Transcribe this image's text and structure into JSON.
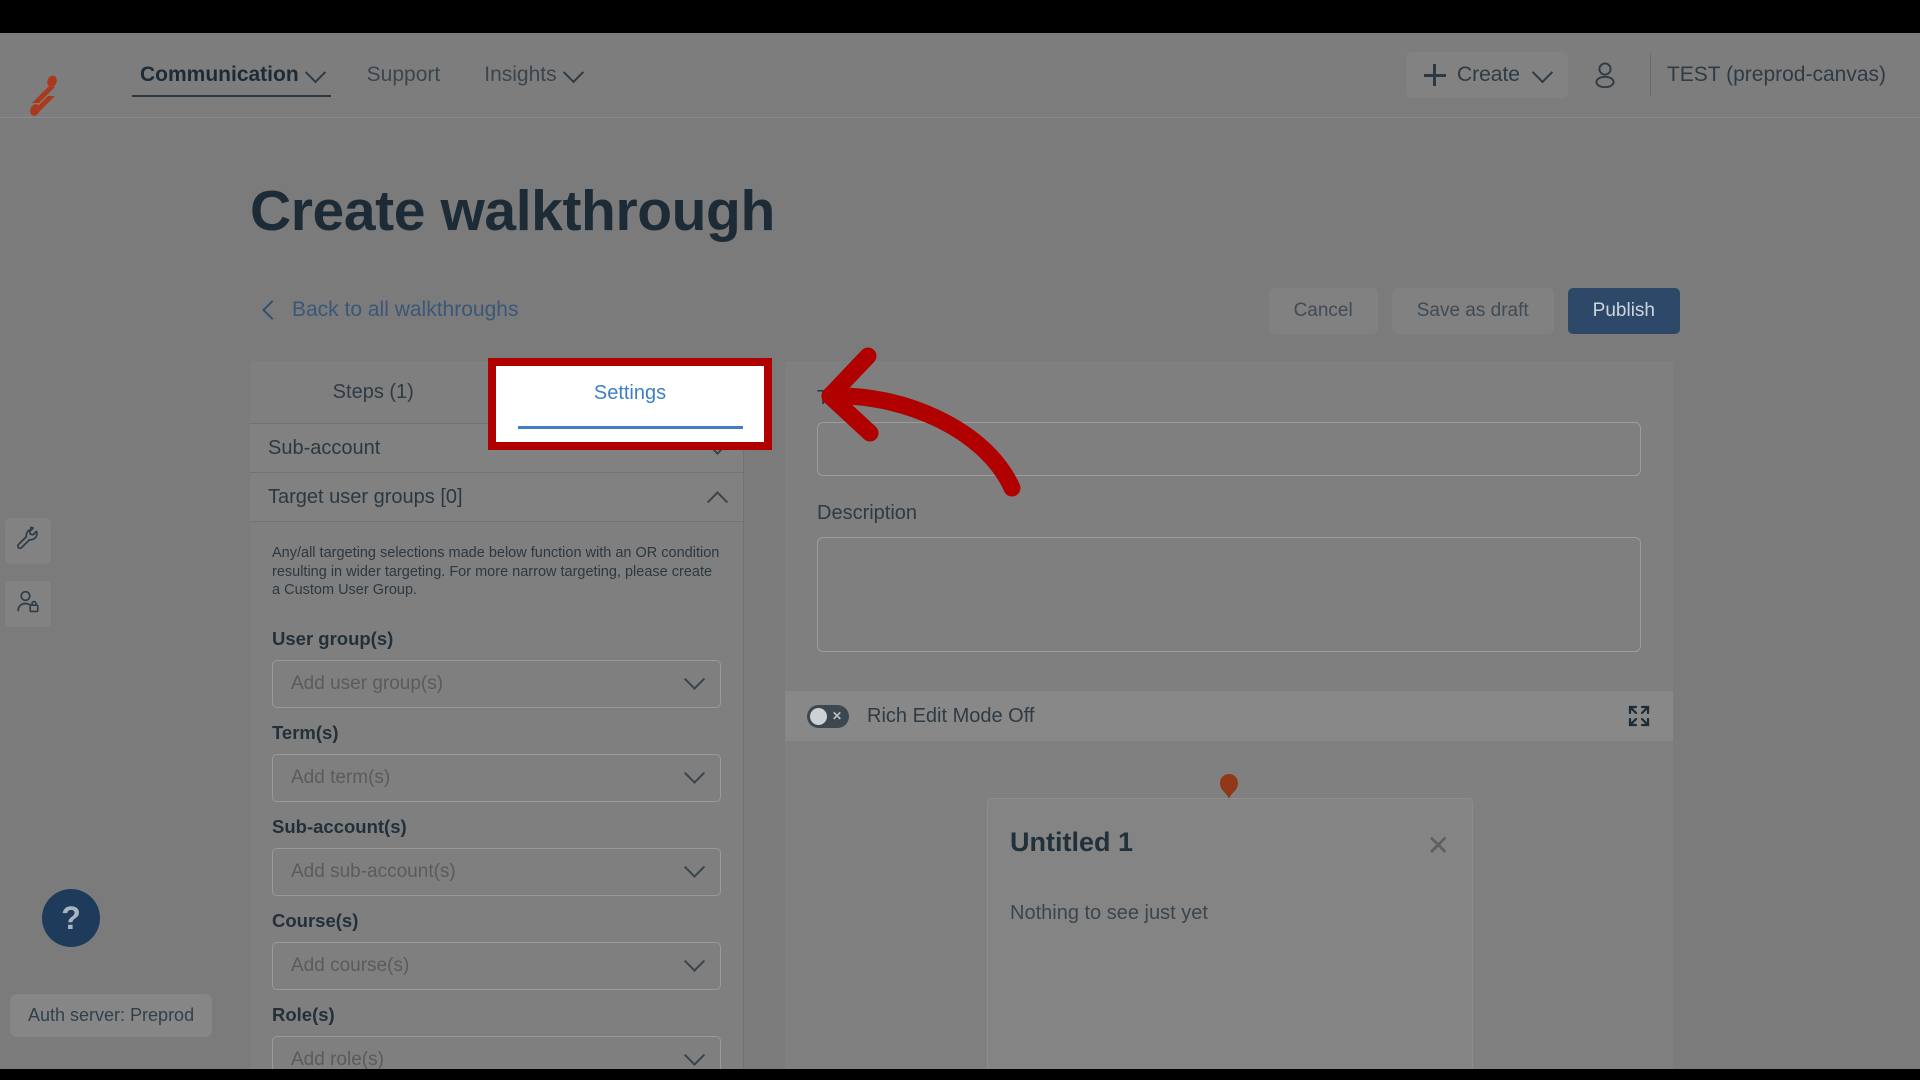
{
  "topnav": {
    "logo_icon": "brand-logo-icon",
    "links": [
      {
        "label": "Communication",
        "has_caret": true,
        "active": true
      },
      {
        "label": "Support",
        "has_caret": false,
        "active": false
      },
      {
        "label": "Insights",
        "has_caret": true,
        "active": false
      }
    ],
    "create_label": "Create",
    "plus_icon": "plus-icon",
    "caret_icon": "chevron-down-icon",
    "account_icon": "person-icon",
    "account_name": "TEST (preprod-canvas)"
  },
  "rail": {
    "items": [
      {
        "icon": "wrench-icon",
        "name": "tools"
      },
      {
        "icon": "user-lock-icon",
        "name": "masquerade"
      }
    ]
  },
  "page": {
    "title": "Create walkthrough",
    "back_link": "Back to all walkthroughs",
    "back_icon": "chevron-left-icon"
  },
  "actions": {
    "cancel": "Cancel",
    "save_draft": "Save as draft",
    "publish": "Publish"
  },
  "tabs": [
    {
      "label": "Steps (1)",
      "selected": false
    },
    {
      "label": "Settings",
      "selected": true
    }
  ],
  "highlight": {
    "tab_label": "Settings",
    "border_color": "#b00000"
  },
  "accordions": [
    {
      "label": "Sub-account",
      "expanded": false,
      "icon": "chevron-down-icon"
    },
    {
      "label": "Target user groups [0]",
      "expanded": true,
      "icon": "chevron-up-icon"
    }
  ],
  "targeting_note": "Any/all targeting selections made below function with an OR condition resulting in wider targeting. For more narrow targeting, please create a Custom User Group.",
  "fields": [
    {
      "label": "User group(s)",
      "placeholder": "Add user group(s)",
      "value": "",
      "icon": "chevron-down-icon"
    },
    {
      "label": "Term(s)",
      "placeholder": "Add term(s)",
      "value": "",
      "icon": "chevron-down-icon"
    },
    {
      "label": "Sub-account(s)",
      "placeholder": "Add sub-account(s)",
      "value": "",
      "icon": "chevron-down-icon"
    },
    {
      "label": "Course(s)",
      "placeholder": "Add course(s)",
      "value": "",
      "icon": "chevron-down-icon"
    },
    {
      "label": "Role(s)",
      "placeholder": "Add role(s)",
      "value": "",
      "icon": "chevron-down-icon"
    }
  ],
  "right": {
    "title_label": "Title",
    "title_value": "",
    "title_placeholder": "",
    "description_label": "Description",
    "description_value": "",
    "description_placeholder": "",
    "rich_edit_label": "Rich Edit Mode Off",
    "rich_edit_on": false,
    "toggle_icon": "toggle-off-icon",
    "expand_icon": "expand-fullscreen-icon"
  },
  "preview": {
    "beacon_icon": "beacon-marker-icon",
    "card_title": "Untitled 1",
    "card_body": "Nothing to see just yet",
    "close_icon": "close-icon"
  },
  "floating": {
    "help_glyph": "?",
    "help_icon": "question-mark-icon",
    "auth_pill": "Auth server: Preprod"
  },
  "colors": {
    "brand_red": "#a93b1c",
    "annotation_red": "#b00000",
    "primary_blue": "#2d4869",
    "link_blue": "#3a5779",
    "tab_blue": "#3f7fc4",
    "page_bg": "#7b7b7b",
    "text_dark": "#1d2b36"
  }
}
